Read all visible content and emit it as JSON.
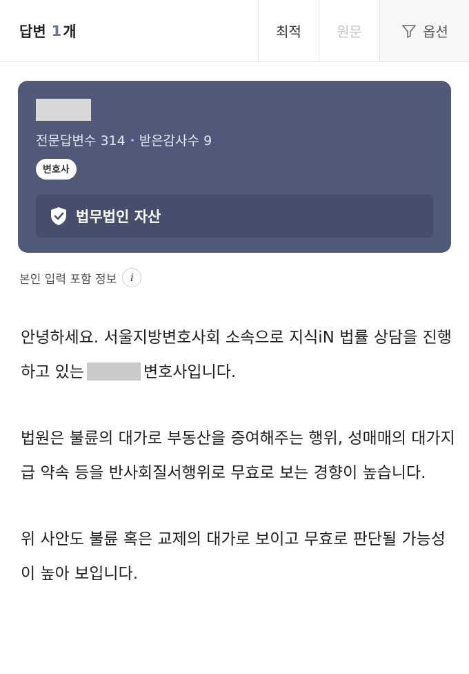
{
  "header": {
    "title": "답변",
    "count": "1",
    "unit": "개",
    "sort_best": "최적",
    "sort_original": "원문",
    "options": "옵션"
  },
  "expert": {
    "stats_answers": "전문답변수 314",
    "stats_thanks": "받은감사수 9",
    "badge": "변호사",
    "firm": "법무법인 자산"
  },
  "info": {
    "label": "본인 입력 포함 정보",
    "icon": "i"
  },
  "answer": {
    "p1a": "안녕하세요. 서울지방변호사회 소속으로 지식iN 법률 상담을 진행하고 있는",
    "p1b": "변호사입니다.",
    "p2": "법원은 불륜의 대가로 부동산을 증여해주는 행위, 성매매의 대가지급 약속 등을 반사회질서행위로 무효로 보는 경향이 높습니다.",
    "p3": "위 사안도 불륜 혹은 교제의 대가로 보이고 무효로 판단될 가능성이 높아 보입니다."
  },
  "colors": {
    "card_bg": "#51597a",
    "firm_bg": "#474e6c",
    "count_accent": "#6b73a6"
  },
  "icons": {
    "filter": "filter-icon",
    "shield": "shield-check-icon",
    "info": "info-icon"
  }
}
